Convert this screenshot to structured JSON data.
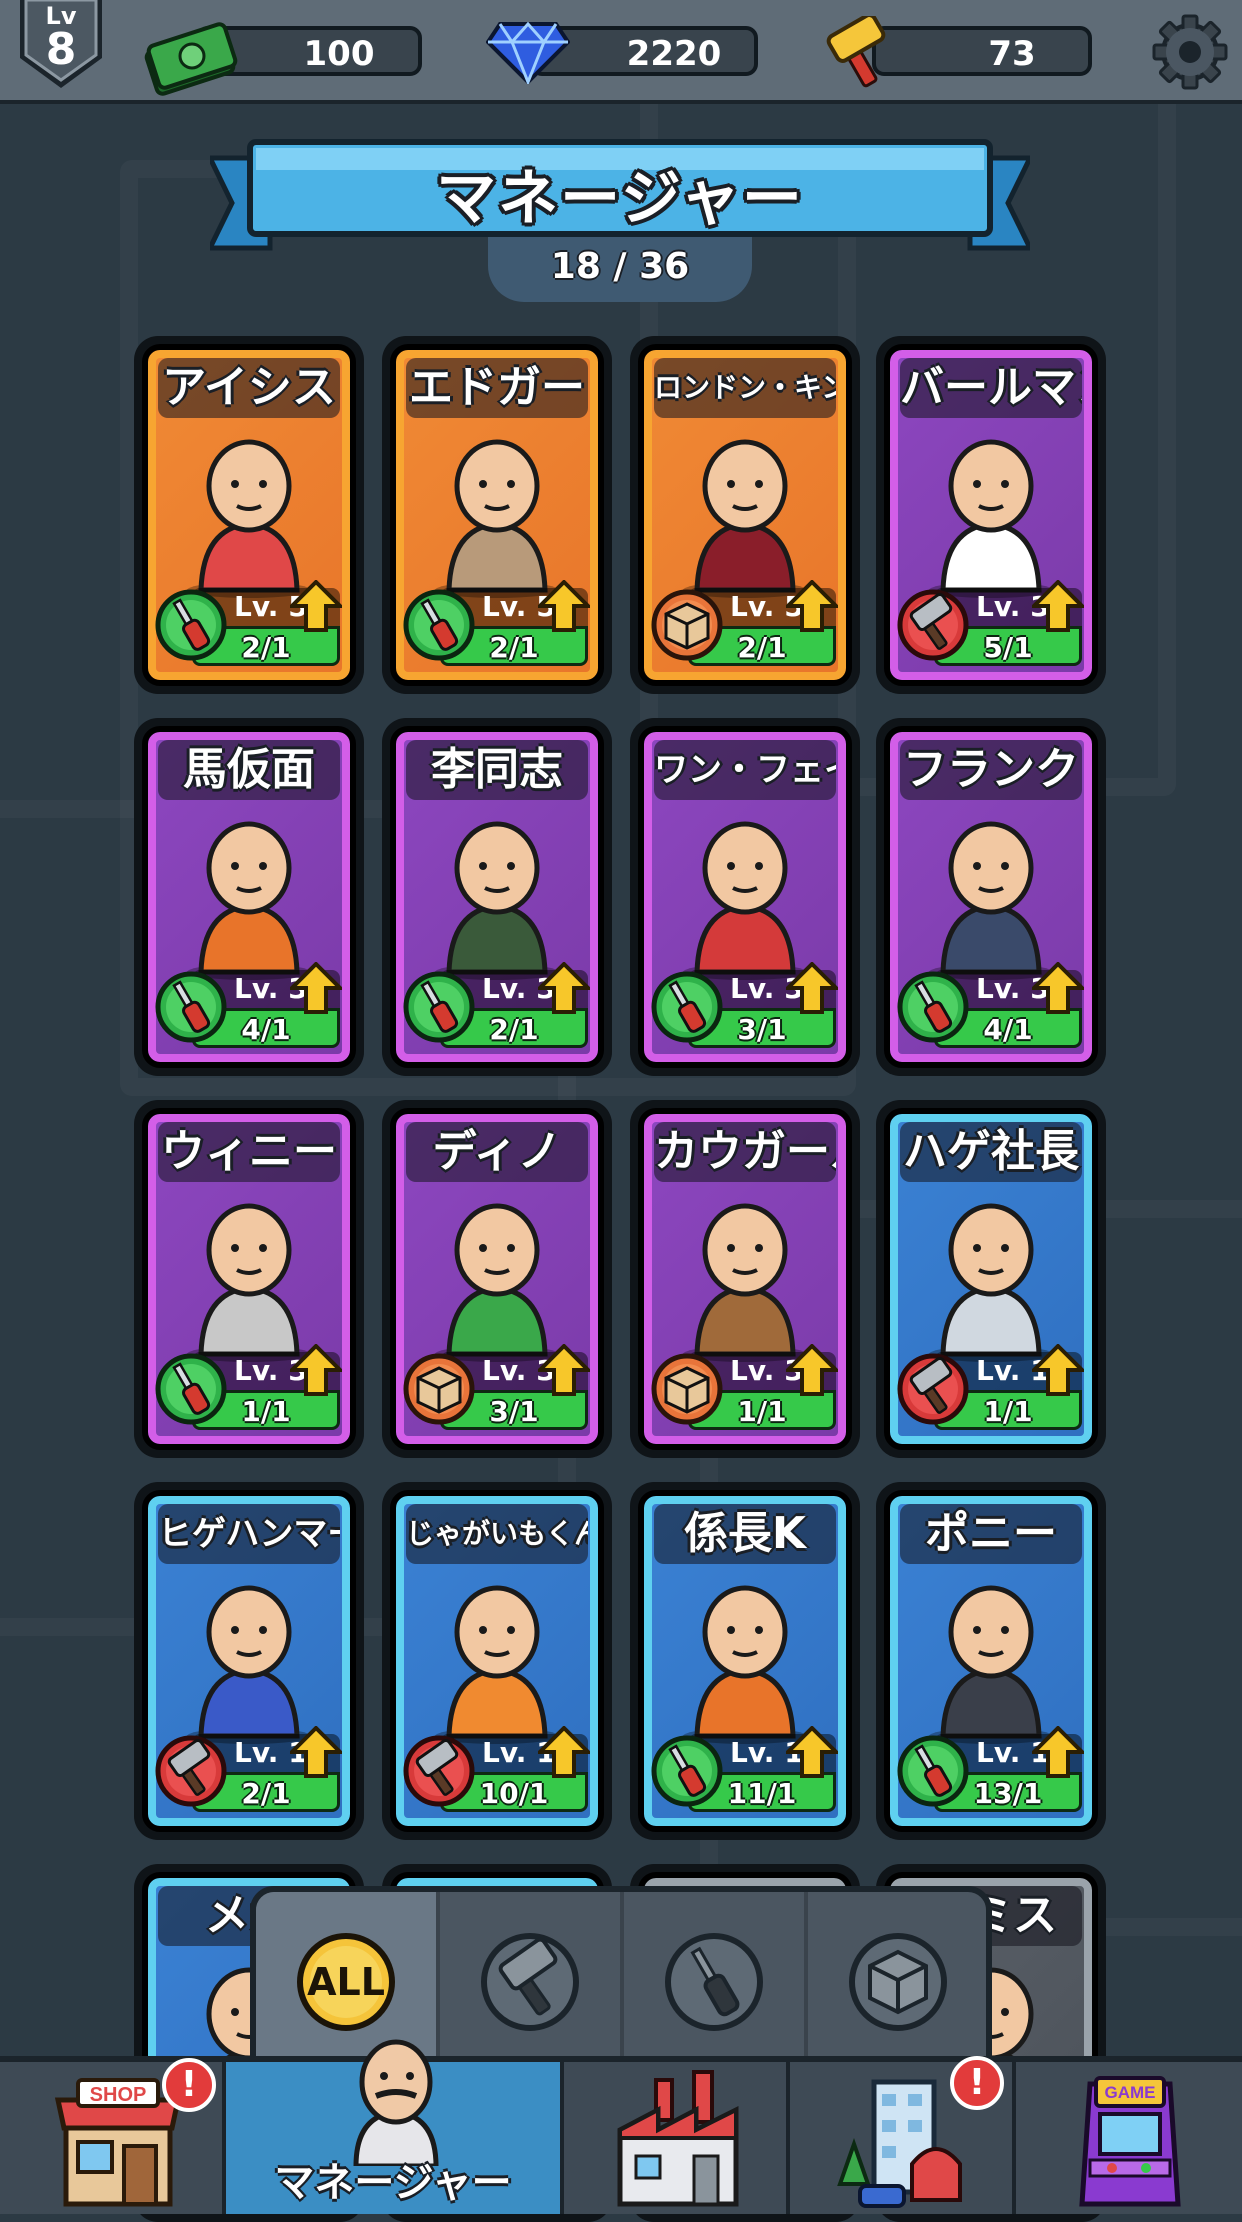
{
  "header": {
    "player_level_label": "Lv",
    "player_level": "8",
    "cash": "100",
    "gems": "2220",
    "hammers": "73",
    "settings_icon": "gear-icon"
  },
  "title": {
    "text": "マネージャー",
    "collected": "18 / 36"
  },
  "cards": [
    {
      "name": "アイシス",
      "level": "Lv. 5",
      "count": "2/1",
      "type": "screwdriver",
      "rarity": "orange"
    },
    {
      "name": "エドガー",
      "level": "Lv. 5",
      "count": "2/1",
      "type": "screwdriver",
      "rarity": "orange"
    },
    {
      "name": "ロンドン・キング",
      "level": "Lv. 5",
      "count": "2/1",
      "type": "box",
      "rarity": "orange"
    },
    {
      "name": "バールマン",
      "level": "Lv. 3",
      "count": "5/1",
      "type": "hammer",
      "rarity": "purple"
    },
    {
      "name": "馬仮面",
      "level": "Lv. 3",
      "count": "4/1",
      "type": "screwdriver",
      "rarity": "purple"
    },
    {
      "name": "李同志",
      "level": "Lv. 3",
      "count": "2/1",
      "type": "screwdriver",
      "rarity": "purple"
    },
    {
      "name": "ワン・フェイ",
      "level": "Lv. 3",
      "count": "3/1",
      "type": "screwdriver",
      "rarity": "purple"
    },
    {
      "name": "フランク",
      "level": "Lv. 3",
      "count": "4/1",
      "type": "screwdriver",
      "rarity": "purple"
    },
    {
      "name": "ウィニー",
      "level": "Lv. 3",
      "count": "1/1",
      "type": "screwdriver",
      "rarity": "purple"
    },
    {
      "name": "ディノ",
      "level": "Lv. 3",
      "count": "3/1",
      "type": "box",
      "rarity": "purple"
    },
    {
      "name": "カウガール",
      "level": "Lv. 3",
      "count": "1/1",
      "type": "box",
      "rarity": "purple"
    },
    {
      "name": "ハゲ社長",
      "level": "Lv. 1",
      "count": "1/1",
      "type": "hammer",
      "rarity": "blue"
    },
    {
      "name": "ヒゲハンマー",
      "level": "Lv. 1",
      "count": "2/1",
      "type": "hammer",
      "rarity": "blue"
    },
    {
      "name": "じゃがいもくん",
      "level": "Lv. 1",
      "count": "10/1",
      "type": "hammer",
      "rarity": "blue"
    },
    {
      "name": "係長K",
      "level": "Lv. 1",
      "count": "11/1",
      "type": "screwdriver",
      "rarity": "blue"
    },
    {
      "name": "ポニー",
      "level": "Lv. 1",
      "count": "13/1",
      "type": "screwdriver",
      "rarity": "blue"
    }
  ],
  "partial_cards": [
    {
      "name": "メガ",
      "rarity": "blue"
    },
    {
      "name": "",
      "rarity": "blue"
    },
    {
      "name": "",
      "rarity": "gray"
    },
    {
      "name": "スミス",
      "rarity": "gray"
    }
  ],
  "filters": [
    {
      "label": "ALL",
      "icon": "all-icon",
      "active": true
    },
    {
      "label": "",
      "icon": "hammer-icon",
      "active": false
    },
    {
      "label": "",
      "icon": "screwdriver-icon",
      "active": false
    },
    {
      "label": "",
      "icon": "box-icon",
      "active": false
    }
  ],
  "nav": [
    {
      "label": "",
      "icon": "shop-icon",
      "badge": "!"
    },
    {
      "label": "マネージャー",
      "icon": "manager-icon",
      "badge": ""
    },
    {
      "label": "",
      "icon": "factory-icon",
      "badge": ""
    },
    {
      "label": "",
      "icon": "city-icon",
      "badge": "!"
    },
    {
      "label": "",
      "icon": "arcade-icon",
      "badge": ""
    }
  ],
  "colors": {
    "orange_frame": "#f7a531",
    "orange_bg": "#e8752a",
    "purple_frame": "#d35ee8",
    "purple_bg": "#7a3aa8",
    "blue_frame": "#5fd0f0",
    "blue_bg": "#2f6fc0",
    "gray_frame": "#9aa3ab",
    "count_green": "#36c94a"
  }
}
